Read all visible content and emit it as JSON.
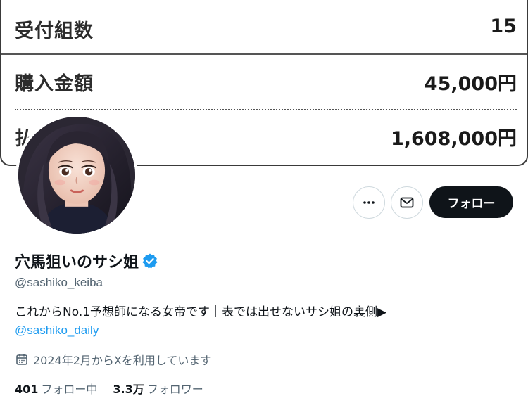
{
  "banner": {
    "rows": [
      {
        "label": "受付組数",
        "value": "15"
      },
      {
        "label": "購入金額",
        "value": "45,000円"
      },
      {
        "label": "払",
        "value": "1,608,000円"
      }
    ]
  },
  "profile": {
    "display_name": "穴馬狙いのサシ姐",
    "handle": "@sashiko_keiba",
    "verified": true,
    "bio_text": "これからNo.1予想師になる女帝です｜表では出せないサシ姐の裏側▶",
    "bio_link": "@sashiko_daily",
    "joined": "2024年2月からXを利用しています",
    "following_count": "401",
    "following_label": "フォロー中",
    "followers_count": "3.3万",
    "followers_label": "フォロワー"
  },
  "actions": {
    "follow_label": "フォロー"
  },
  "icons": {
    "more": "more-icon",
    "mail": "mail-icon",
    "verified": "verified-badge-icon",
    "calendar": "calendar-icon"
  },
  "colors": {
    "follow_button": "#0f1419",
    "link": "#1d9bf0",
    "verified": "#1d9bf0",
    "secondary_text": "#536471"
  }
}
